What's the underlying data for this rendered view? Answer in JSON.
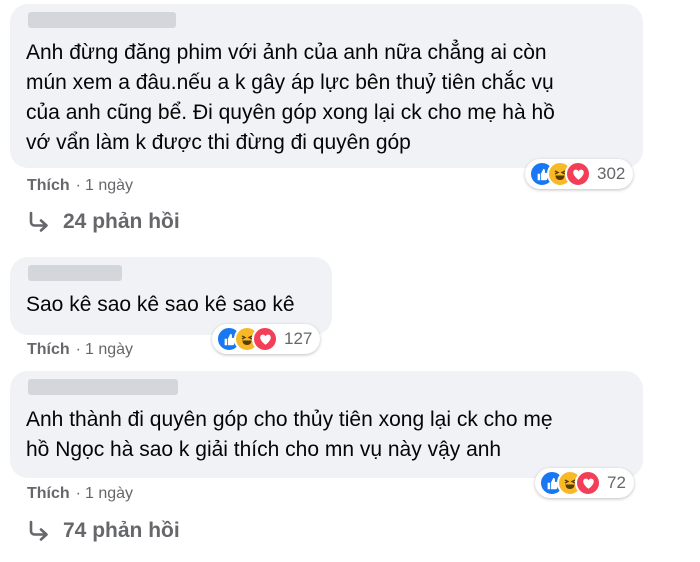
{
  "colors": {
    "bubble": "#f0f2f5",
    "meta": "#65676b",
    "like": "#1877f2",
    "haha": "#f7b928",
    "love": "#f33e58"
  },
  "comments": [
    {
      "lines": [
        "Anh đừng đăng phim với ảnh của anh nữa chẳng ai còn",
        "mún xem a đâu.nếu a k gây áp lực bên thuỷ tiên chắc vụ",
        "của anh cũng bể. Đi quyên góp xong lại ck cho mẹ hà hồ",
        "vớ vẩn làm k được thi đừng đi quyên góp"
      ],
      "like_label": "Thích",
      "time": "1 ngày",
      "reaction_count": "302",
      "reactions": [
        "like-icon",
        "haha-icon",
        "love-icon"
      ],
      "replies": "24 phản hồi"
    },
    {
      "lines": [
        "Sao kê sao kê sao kê sao kê"
      ],
      "like_label": "Thích",
      "time": "1 ngày",
      "reaction_count": "127",
      "reactions": [
        "like-icon",
        "haha-icon",
        "love-icon"
      ]
    },
    {
      "lines": [
        "Anh thành đi quyên góp cho thủy tiên xong lại ck cho mẹ",
        "hồ Ngọc hà sao k giải thích cho mn vụ này vậy anh"
      ],
      "like_label": "Thích",
      "time": "1 ngày",
      "reaction_count": "72",
      "reactions": [
        "like-icon",
        "haha-icon",
        "love-icon"
      ],
      "replies": "74 phản hồi"
    }
  ]
}
